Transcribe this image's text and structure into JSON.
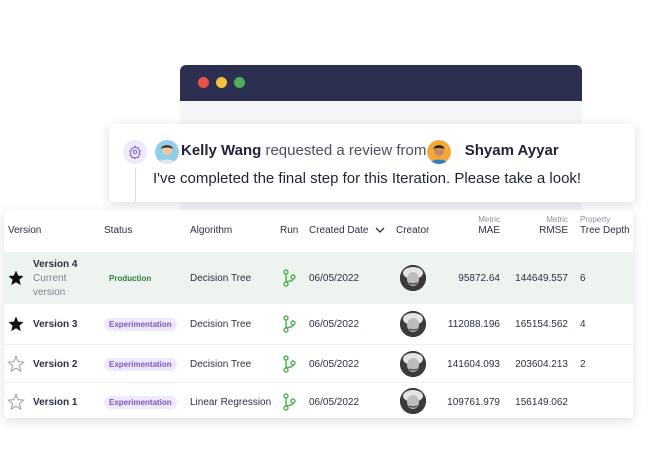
{
  "window": {
    "controls": [
      {
        "name": "close",
        "color": "#e9534d"
      },
      {
        "name": "minimize",
        "color": "#f2c13d"
      },
      {
        "name": "maximize",
        "color": "#4cb15a"
      }
    ],
    "bar_color": "#2b3050"
  },
  "review": {
    "icon": "gear-icon",
    "requester": "Kelly Wang",
    "action_text": "requested a review from",
    "reviewer": "Shyam Ayyar",
    "message": "I've completed the final step for this Iteration. Please take a look!"
  },
  "table": {
    "headers": {
      "version": "Version",
      "status": "Status",
      "algorithm": "Algorithm",
      "run": "Run",
      "created_date": "Created Date",
      "creator": "Creator",
      "mae_group": "Metric",
      "mae": "MAE",
      "rmse_group": "Metric",
      "rmse": "RMSE",
      "depth_group": "Property",
      "depth": "Tree Depth"
    },
    "rows": [
      {
        "version": "Version 4",
        "subtitle_1": "Current",
        "subtitle_2": "version",
        "starred": true,
        "status": "Production",
        "algorithm": "Decision Tree",
        "run_icon": "git-branch-icon",
        "created": "06/05/2022",
        "mae": "95872.64",
        "rmse": "144649.557",
        "depth": "6"
      },
      {
        "version": "Version 3",
        "starred": true,
        "status": "Experimentation",
        "algorithm": "Decision Tree",
        "run_icon": "git-branch-icon",
        "created": "06/05/2022",
        "mae": "112088.196",
        "rmse": "165154.562",
        "depth": "4"
      },
      {
        "version": "Version 2",
        "starred": false,
        "status": "Experimentation",
        "algorithm": "Decision Tree",
        "run_icon": "git-branch-icon",
        "created": "06/05/2022",
        "mae": "141604.093",
        "rmse": "203604.213",
        "depth": "2"
      },
      {
        "version": "Version 1",
        "starred": false,
        "status": "Experimentation",
        "algorithm": "Linear Regression",
        "run_icon": "git-branch-icon",
        "created": "06/05/2022",
        "mae": "109761.979",
        "rmse": "156149.062",
        "depth": ""
      }
    ],
    "colors": {
      "production": "#2e7d3a",
      "experimentation": "#7b55c7",
      "experimentation_bg": "#efe9fb",
      "highlight_row": "#edf4ef",
      "run_icon": "#4caf50"
    }
  }
}
